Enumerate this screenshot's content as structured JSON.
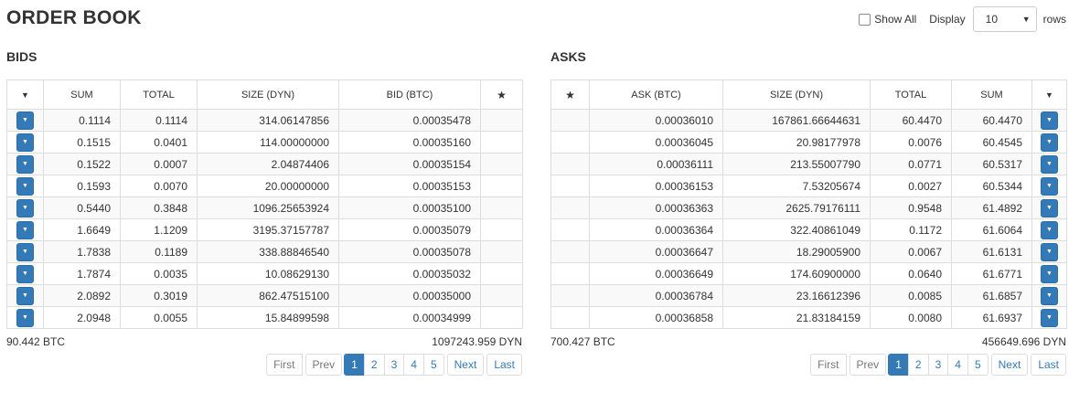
{
  "page": {
    "title": "ORDER BOOK"
  },
  "controls": {
    "show_all_label": "Show All",
    "display_label": "Display",
    "rows_select_value": "10",
    "rows_label": "rows"
  },
  "bids": {
    "title": "BIDS",
    "columns": [
      "SUM",
      "TOTAL",
      "SIZE (DYN)",
      "BID (BTC)"
    ],
    "rows": [
      {
        "sum": "0.1114",
        "total": "0.1114",
        "size": "314.06147856",
        "price": "0.00035478"
      },
      {
        "sum": "0.1515",
        "total": "0.0401",
        "size": "114.00000000",
        "price": "0.00035160"
      },
      {
        "sum": "0.1522",
        "total": "0.0007",
        "size": "2.04874406",
        "price": "0.00035154"
      },
      {
        "sum": "0.1593",
        "total": "0.0070",
        "size": "20.00000000",
        "price": "0.00035153"
      },
      {
        "sum": "0.5440",
        "total": "0.3848",
        "size": "1096.25653924",
        "price": "0.00035100"
      },
      {
        "sum": "1.6649",
        "total": "1.1209",
        "size": "3195.37157787",
        "price": "0.00035079"
      },
      {
        "sum": "1.7838",
        "total": "0.1189",
        "size": "338.88846540",
        "price": "0.00035078"
      },
      {
        "sum": "1.7874",
        "total": "0.0035",
        "size": "10.08629130",
        "price": "0.00035032"
      },
      {
        "sum": "2.0892",
        "total": "0.3019",
        "size": "862.47515100",
        "price": "0.00035000"
      },
      {
        "sum": "2.0948",
        "total": "0.0055",
        "size": "15.84899598",
        "price": "0.00034999"
      }
    ],
    "footer_left": "90.442 BTC",
    "footer_right": "1097243.959 DYN"
  },
  "asks": {
    "title": "ASKS",
    "columns": [
      "ASK (BTC)",
      "SIZE (DYN)",
      "TOTAL",
      "SUM"
    ],
    "rows": [
      {
        "price": "0.00036010",
        "size": "167861.66644631",
        "total": "60.4470",
        "sum": "60.4470"
      },
      {
        "price": "0.00036045",
        "size": "20.98177978",
        "total": "0.0076",
        "sum": "60.4545"
      },
      {
        "price": "0.00036111",
        "size": "213.55007790",
        "total": "0.0771",
        "sum": "60.5317"
      },
      {
        "price": "0.00036153",
        "size": "7.53205674",
        "total": "0.0027",
        "sum": "60.5344"
      },
      {
        "price": "0.00036363",
        "size": "2625.79176111",
        "total": "0.9548",
        "sum": "61.4892"
      },
      {
        "price": "0.00036364",
        "size": "322.40861049",
        "total": "0.1172",
        "sum": "61.6064"
      },
      {
        "price": "0.00036647",
        "size": "18.29005900",
        "total": "0.0067",
        "sum": "61.6131"
      },
      {
        "price": "0.00036649",
        "size": "174.60900000",
        "total": "0.0640",
        "sum": "61.6771"
      },
      {
        "price": "0.00036784",
        "size": "23.16612396",
        "total": "0.0085",
        "sum": "61.6857"
      },
      {
        "price": "0.00036858",
        "size": "21.83184159",
        "total": "0.0080",
        "sum": "61.6937"
      }
    ],
    "footer_left": "700.427 BTC",
    "footer_right": "456649.696 DYN"
  },
  "pagination": {
    "first": "First",
    "prev": "Prev",
    "pages": [
      "1",
      "2",
      "3",
      "4",
      "5"
    ],
    "active_page": "1",
    "next": "Next",
    "last": "Last"
  },
  "icons": {
    "sort": "caret-down-icon",
    "favorite": "star-icon",
    "row_action": "caret-down-icon"
  },
  "colors": {
    "primary": "#337ab7",
    "border": "#dddddd",
    "stripe": "#f9f9f9"
  }
}
